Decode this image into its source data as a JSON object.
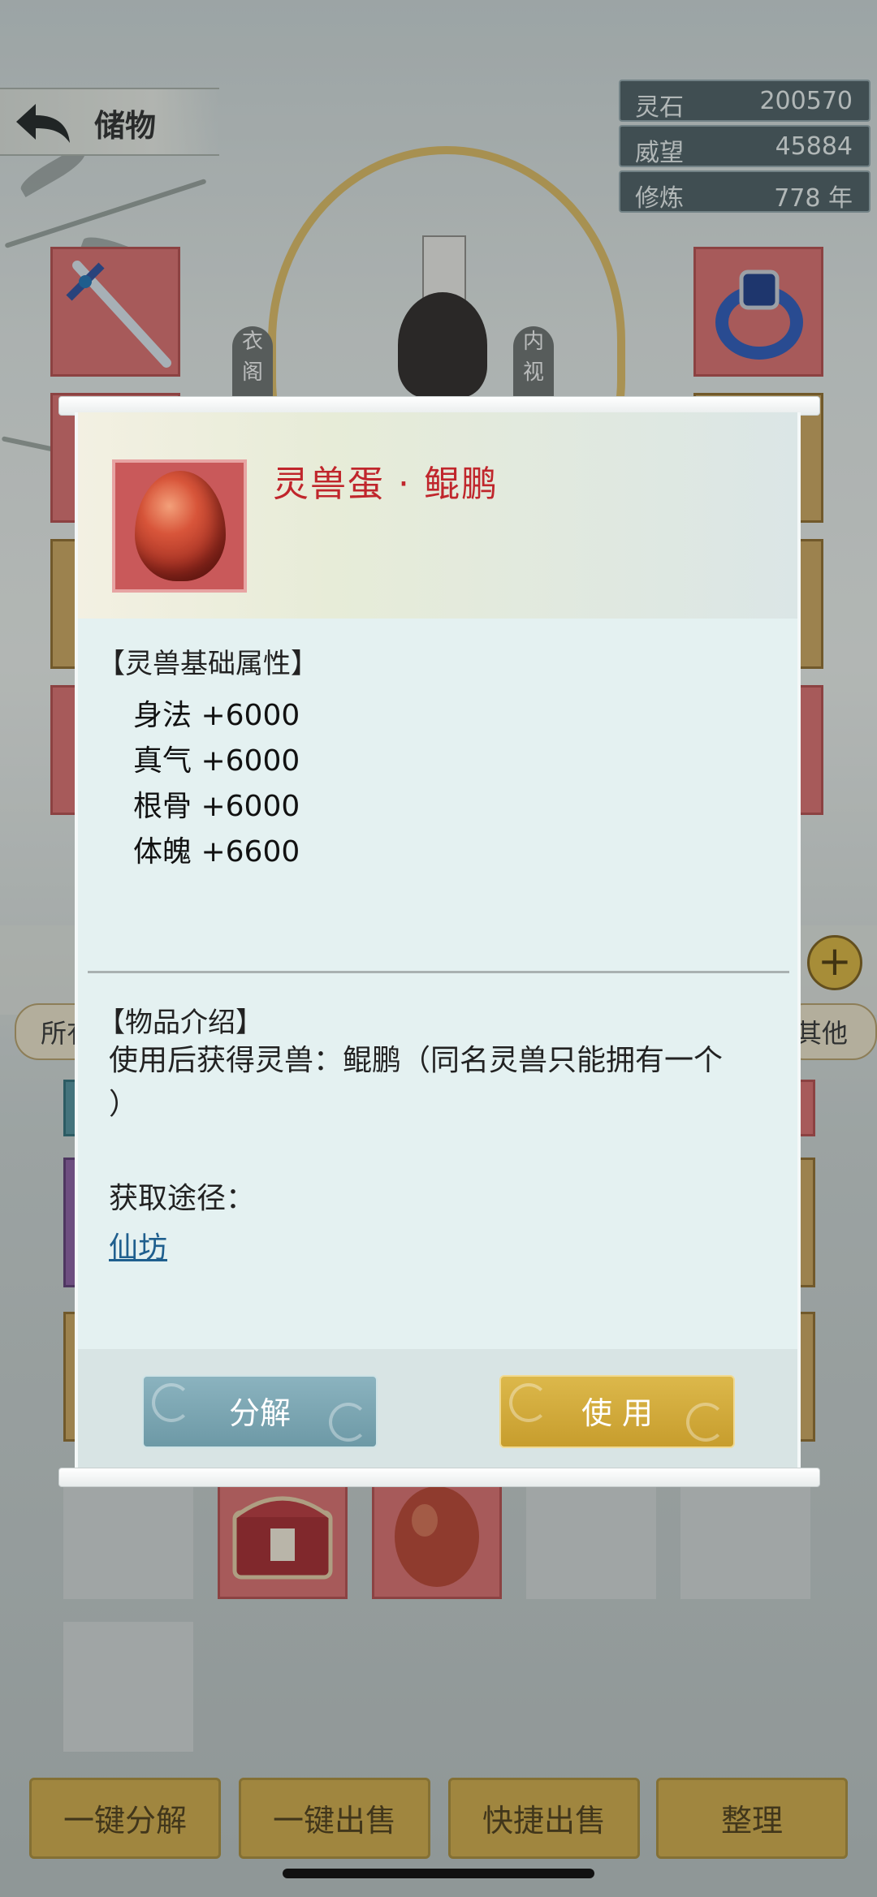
{
  "header": {
    "back_title": "储物"
  },
  "stats": [
    {
      "label": "灵石",
      "value": "200570"
    },
    {
      "label": "威望",
      "value": "45884"
    },
    {
      "label": "修炼",
      "value": "778 年"
    }
  ],
  "side_buttons": {
    "left": "衣阁",
    "right": "内视"
  },
  "category_tabs": {
    "first": "所有",
    "last": "其他"
  },
  "item": {
    "name": "灵兽蛋 · 鲲鹏",
    "icon": "egg-icon",
    "base_attr_title": "【灵兽基础属性】",
    "attributes": [
      {
        "name": "身法",
        "value": "+6000"
      },
      {
        "name": "真气",
        "value": "+6000"
      },
      {
        "name": "根骨",
        "value": "+6000"
      },
      {
        "name": "体魄",
        "value": "+6600"
      }
    ],
    "intro_title": "【物品介绍】",
    "intro_line1": "使用后获得灵兽：鲲鹏（同名灵兽只能拥有一个",
    "intro_line2": "）",
    "source_label": "获取途径：",
    "source_link": "仙坊"
  },
  "modal_buttons": {
    "decompose": "分解",
    "use": "使 用"
  },
  "bottom_actions": [
    "一键分解",
    "一键出售",
    "快捷出售",
    "整理"
  ],
  "colors": {
    "item_name": "#c0262c",
    "link": "#1f5f8e",
    "gold_button": "#cfa846",
    "teal_button": "#7aa6b2"
  }
}
